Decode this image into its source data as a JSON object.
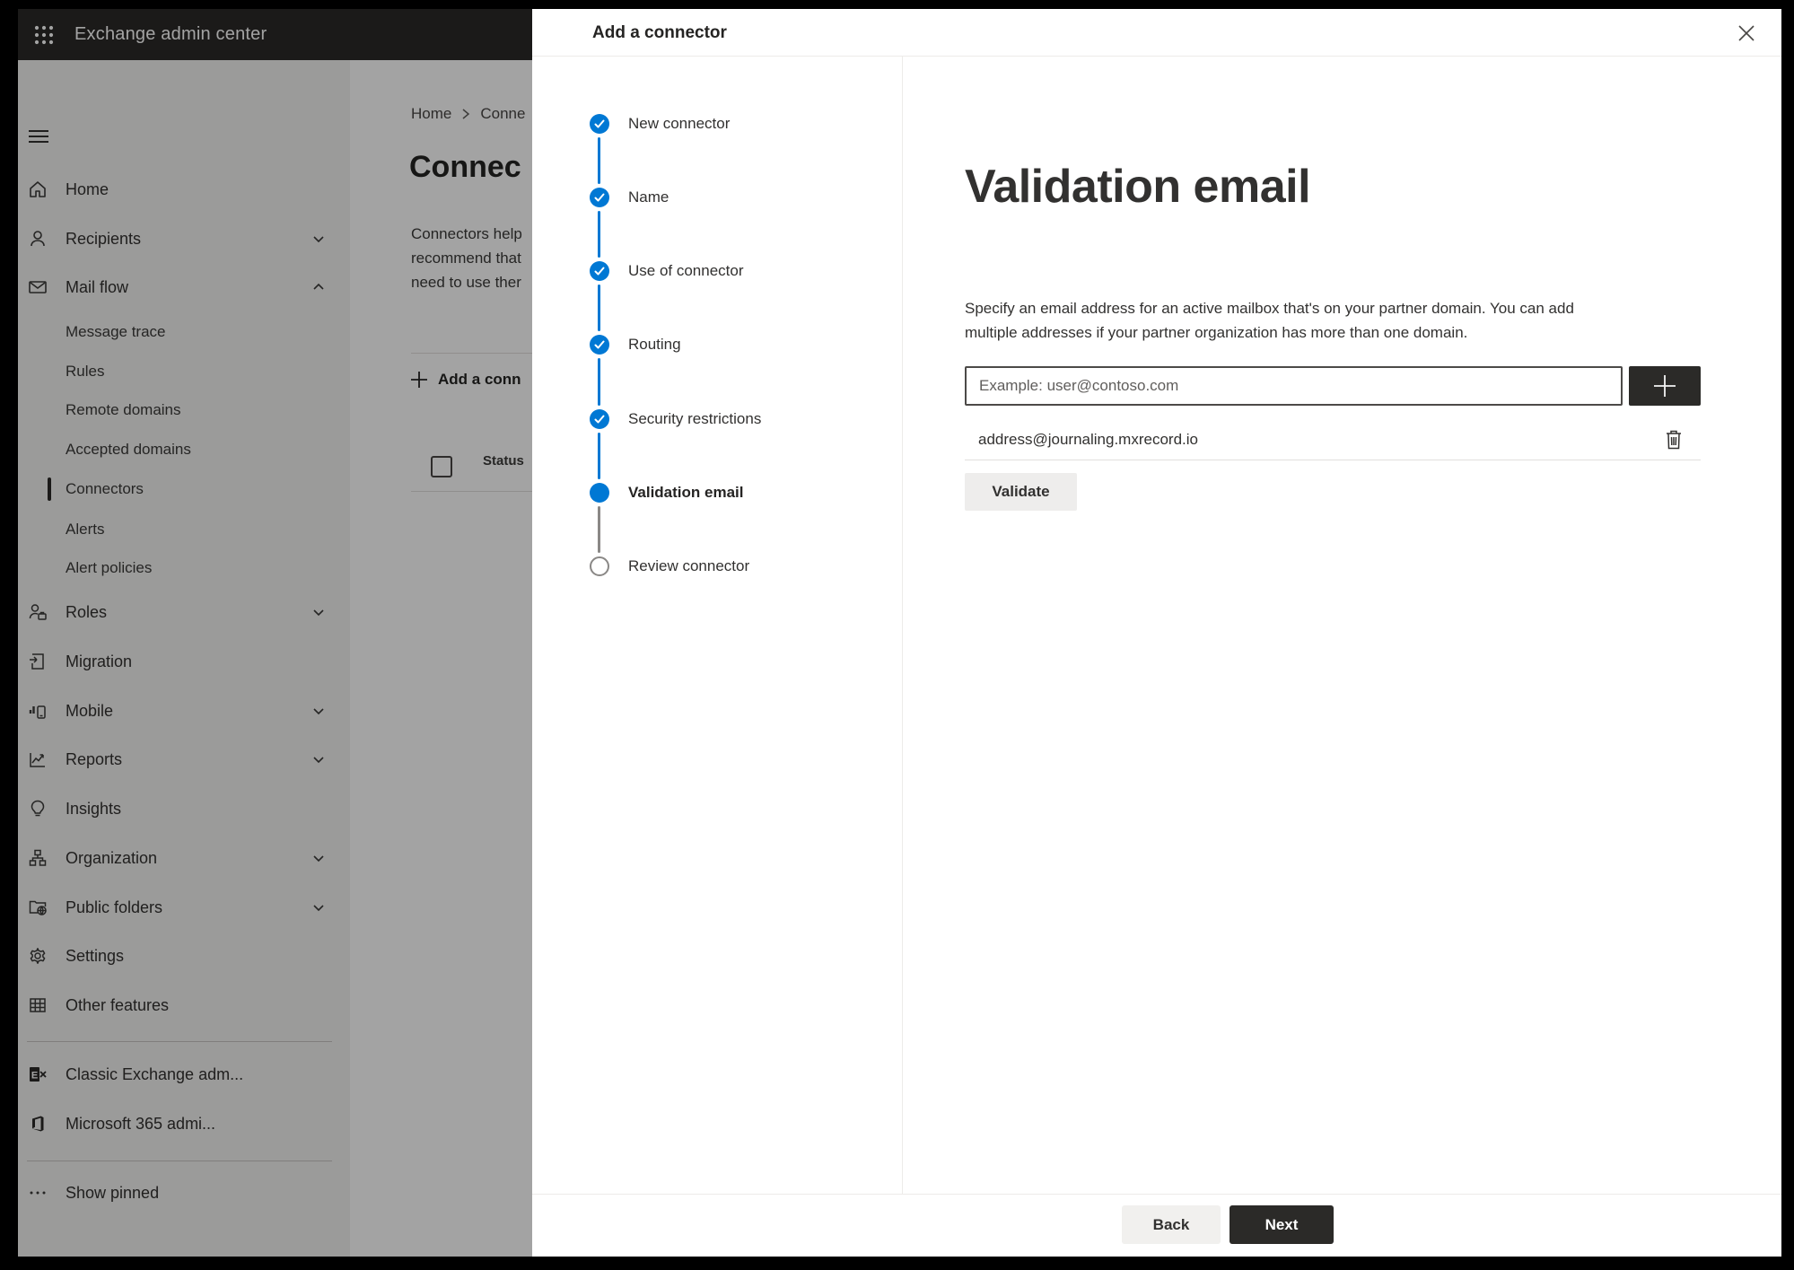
{
  "colors": {
    "accent_blue": "#0078d4",
    "dark_button": "#2b2a28",
    "topbar_bg": "#2b2a28",
    "sidebar_bg": "#f3f2f1",
    "overlay": "rgba(0,0,0,0.36)",
    "pending_gray": "#8a8886",
    "divider": "#edebe9"
  },
  "icons": {
    "app_launcher": "waffle-grid",
    "hamburger": "three-lines",
    "home": "house",
    "recipients": "person",
    "mail_flow": "envelope",
    "roles": "person-with-briefcase",
    "migration": "document-with-arrow",
    "mobile": "bar-chart-with-phone",
    "reports": "trend-line-chart",
    "insights": "lightbulb",
    "organization": "org-chart",
    "public_folders": "folder-with-globe",
    "settings": "gear",
    "other_features": "grid-table",
    "classic_exchange": "exchange-logo",
    "microsoft_365": "office-logo",
    "show_pinned": "ellipsis",
    "chevron_down": "⌄",
    "chevron_up": "⌃",
    "breadcrumb_chevron": "›",
    "step_done": "check-in-circle",
    "close": "✕",
    "plus": "+",
    "trash": "trash-can"
  },
  "topbar": {
    "app_title": "Exchange admin center"
  },
  "sidebar": {
    "items": [
      {
        "label": "Home"
      },
      {
        "label": "Recipients",
        "chevron": "down"
      },
      {
        "label": "Mail flow",
        "chevron": "up",
        "expanded": true
      },
      {
        "label": "Message trace",
        "sub": true
      },
      {
        "label": "Rules",
        "sub": true
      },
      {
        "label": "Remote domains",
        "sub": true
      },
      {
        "label": "Accepted domains",
        "sub": true
      },
      {
        "label": "Connectors",
        "sub": true,
        "selected": true
      },
      {
        "label": "Alerts",
        "sub": true
      },
      {
        "label": "Alert policies",
        "sub": true
      },
      {
        "label": "Roles",
        "chevron": "down"
      },
      {
        "label": "Migration"
      },
      {
        "label": "Mobile",
        "chevron": "down"
      },
      {
        "label": "Reports",
        "chevron": "down"
      },
      {
        "label": "Insights"
      },
      {
        "label": "Organization",
        "chevron": "down"
      },
      {
        "label": "Public folders",
        "chevron": "down"
      },
      {
        "label": "Settings"
      },
      {
        "label": "Other features"
      },
      {
        "label": "Classic Exchange adm..."
      },
      {
        "label": "Microsoft 365 admi..."
      },
      {
        "label": "Show pinned"
      }
    ]
  },
  "page": {
    "breadcrumb": {
      "home": "Home",
      "current": "Conne"
    },
    "title": "Connec",
    "paragraph_lines": [
      "Connectors help",
      "recommend that",
      "need to use ther"
    ],
    "add_button_label": "Add a conn",
    "table": {
      "status_header": "Status"
    }
  },
  "modal": {
    "title": "Add a connector",
    "steps": [
      {
        "label": "New connector",
        "state": "done"
      },
      {
        "label": "Name",
        "state": "done"
      },
      {
        "label": "Use of connector",
        "state": "done"
      },
      {
        "label": "Routing",
        "state": "done"
      },
      {
        "label": "Security restrictions",
        "state": "done"
      },
      {
        "label": "Validation email",
        "state": "current"
      },
      {
        "label": "Review connector",
        "state": "pending"
      }
    ],
    "content": {
      "heading": "Validation email",
      "description_lines": [
        "Specify an email address for an active mailbox that's on your partner domain. You can add",
        "multiple addresses if your partner organization has more than one domain."
      ],
      "email_input": {
        "value": "",
        "placeholder": "Example: user@contoso.com"
      },
      "addresses": [
        "address@journaling.mxrecord.io"
      ],
      "validate_button": "Validate"
    },
    "footer": {
      "back_button": "Back",
      "next_button": "Next"
    }
  }
}
